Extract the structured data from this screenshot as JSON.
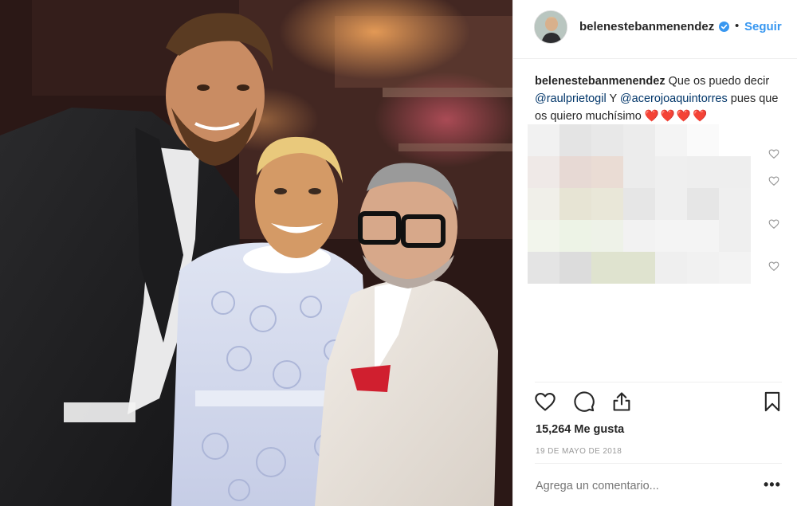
{
  "post": {
    "image_alt": "",
    "username": "belenestebanmenendez",
    "verified": true,
    "follow_label": "Seguir",
    "separator": "•",
    "caption": {
      "user": "belenestebanmenendez",
      "text_1": " Que os puedo decir ",
      "mention_1": "@raulprietogil",
      "text_2": " Y ",
      "mention_2": "@acerojoaquintorres",
      "text_3": " pues que os quiero muchísimo ",
      "hearts": "❤️❤️❤️❤️"
    },
    "likes_label": "15,264 Me gusta",
    "date_label": "19 DE MAYO DE 2018",
    "comment_placeholder": "Agrega un comentario...",
    "more_label": "•••"
  },
  "icons": {
    "verified": "verified-badge-icon",
    "like": "heart-icon",
    "comment": "comment-bubble-icon",
    "share": "share-icon",
    "save": "bookmark-icon",
    "comment_like": "small-heart-icon"
  },
  "colors": {
    "accent": "#3897f0",
    "mention": "#003569",
    "muted": "#999999",
    "text": "#262626"
  }
}
